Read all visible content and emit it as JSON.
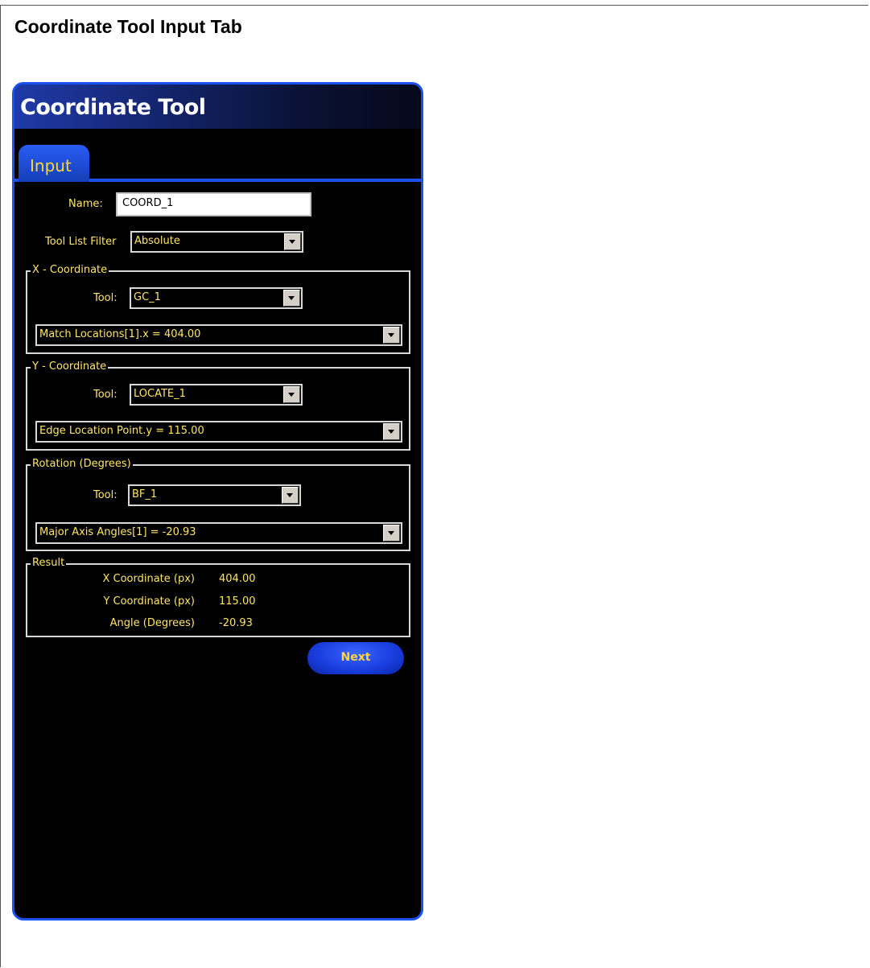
{
  "page": {
    "title": "Coordinate Tool Input Tab"
  },
  "window": {
    "title": "Coordinate Tool"
  },
  "tabs": [
    {
      "label": "Input",
      "active": true
    }
  ],
  "form": {
    "name_label": "Name:",
    "name_value": "COORD_1",
    "filter_label": "Tool List Filter",
    "filter_value": "Absolute"
  },
  "x_coordinate": {
    "legend": "X - Coordinate",
    "tool_label": "Tool:",
    "tool_value": "GC_1",
    "property_value": "Match Locations[1].x = 404.00"
  },
  "y_coordinate": {
    "legend": "Y - Coordinate",
    "tool_label": "Tool:",
    "tool_value": "LOCATE_1",
    "property_value": "Edge Location Point.y = 115.00"
  },
  "rotation": {
    "legend": "Rotation (Degrees)",
    "tool_label": "Tool:",
    "tool_value": "BF_1",
    "property_value": "Major Axis Angles[1] = -20.93"
  },
  "result": {
    "legend": "Result",
    "rows": [
      {
        "label": "X Coordinate (px)",
        "value": "404.00"
      },
      {
        "label": "Y Coordinate (px)",
        "value": "115.00"
      },
      {
        "label": "Angle (Degrees)",
        "value": "-20.93"
      }
    ]
  },
  "buttons": {
    "next_label": "Next"
  },
  "colors": {
    "panel_background": "#000000",
    "accent_blue": "#1a52f2",
    "label_yellow": "#ffe566"
  }
}
